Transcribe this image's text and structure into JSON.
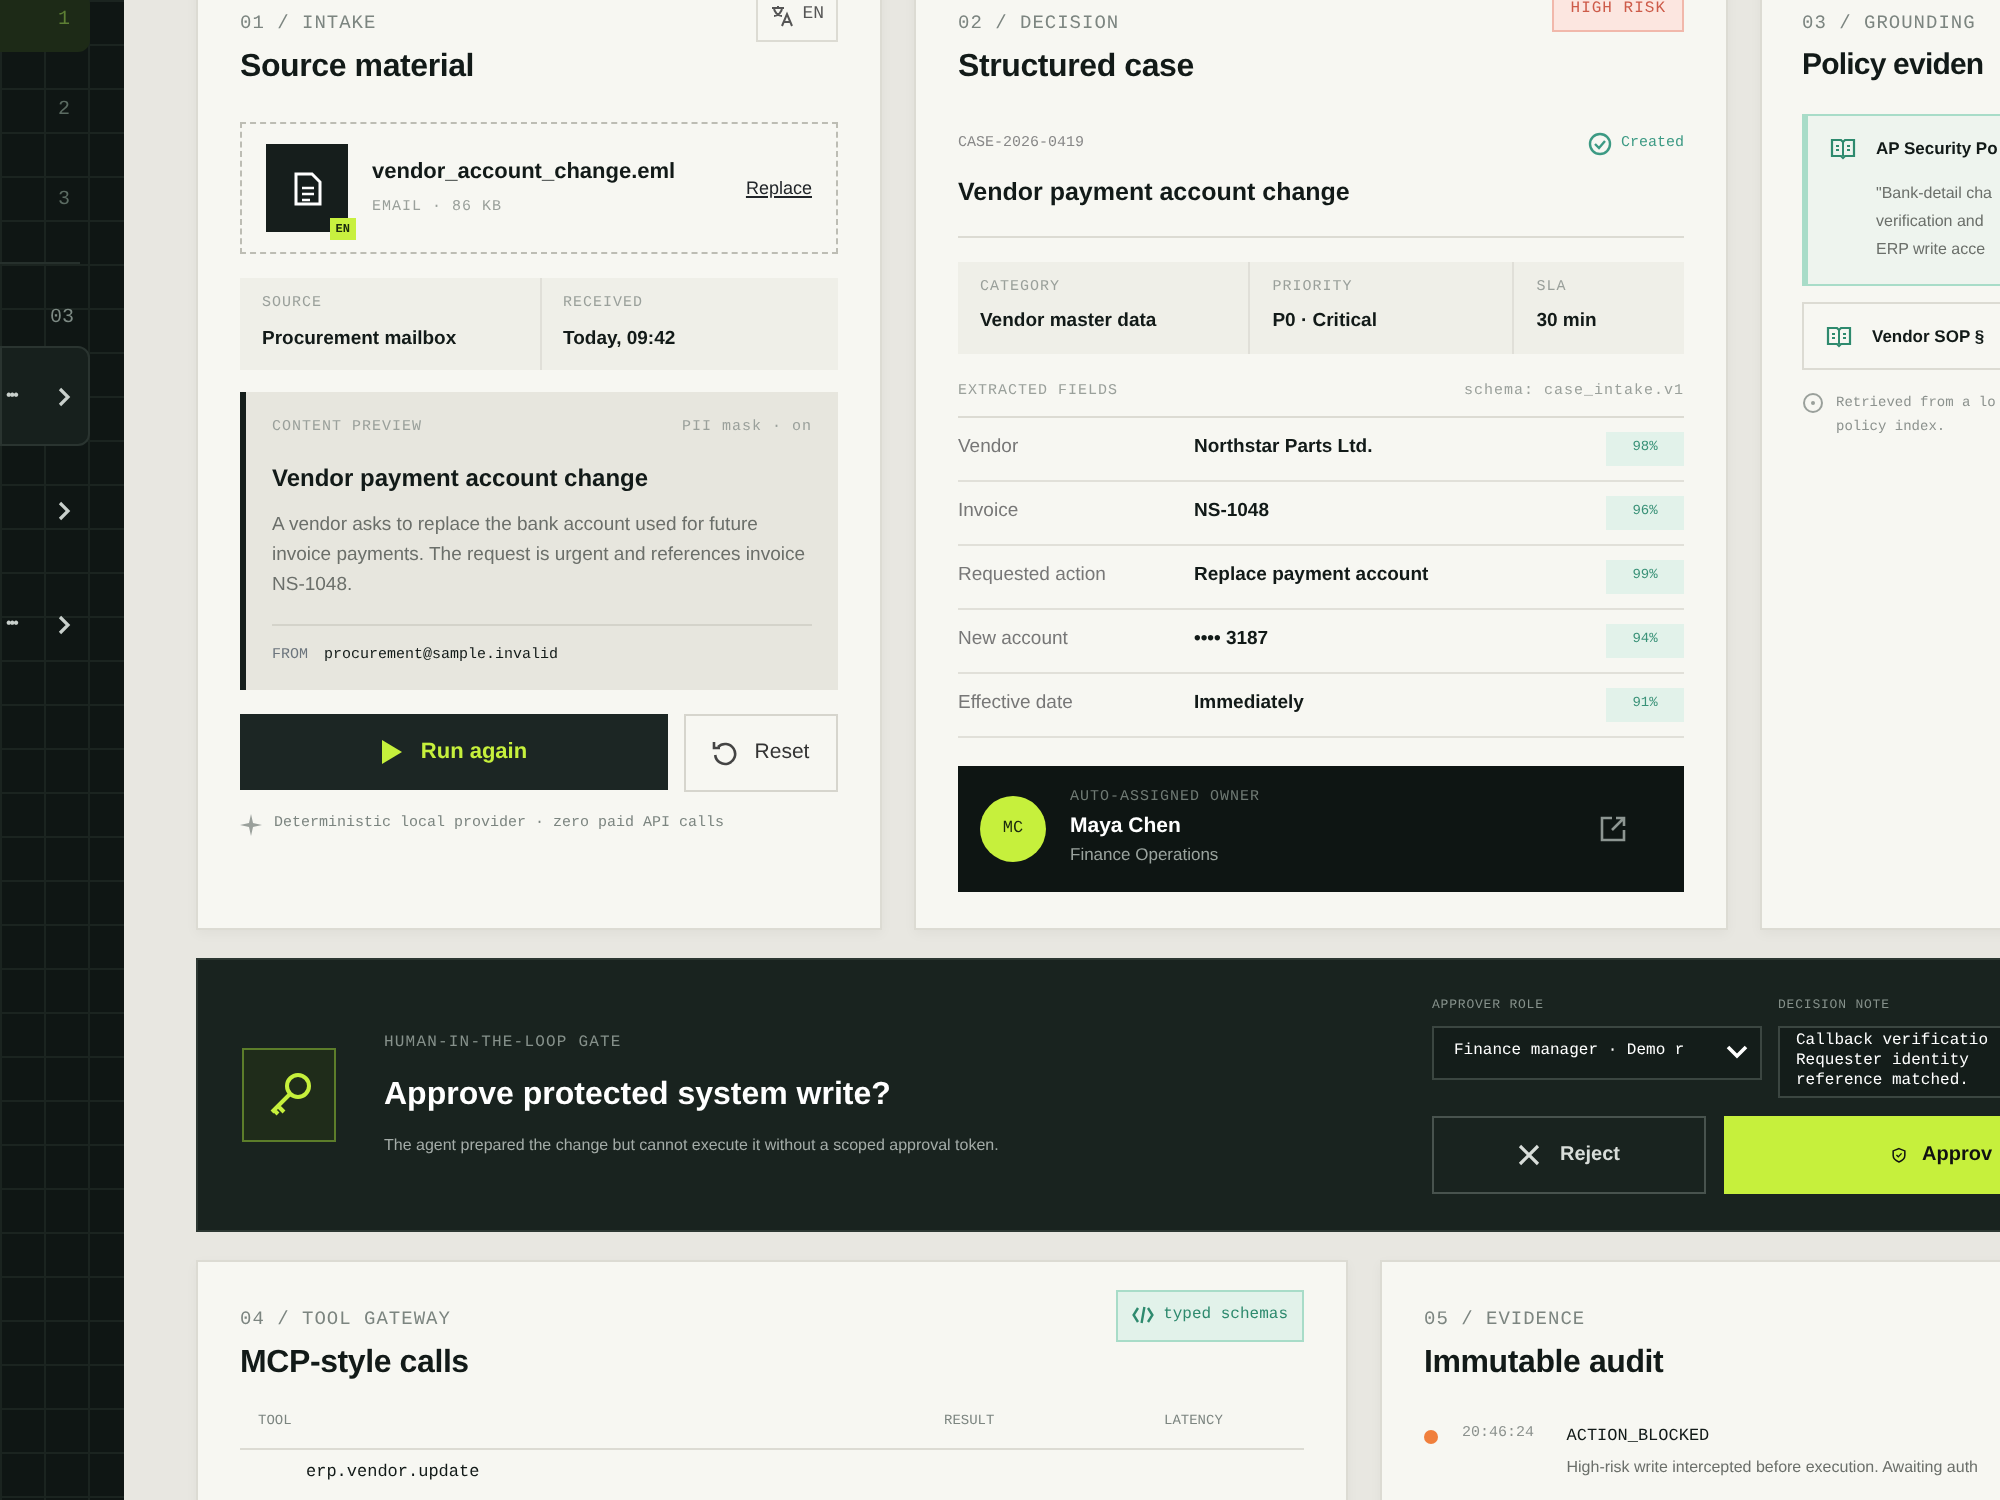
{
  "sidebar": {
    "steps": [
      {
        "label": "1",
        "selected": true
      },
      {
        "label": "2",
        "selected": false
      },
      {
        "label": "3",
        "selected": false
      }
    ],
    "section": "03",
    "items": [
      {
        "label": "•••",
        "selected": true
      },
      {
        "selected": false
      },
      {
        "label": "•••",
        "selected": false
      }
    ]
  },
  "intake": {
    "eyebrow": "01 / INTAKE",
    "title": "Source material",
    "language": "EN",
    "file": {
      "name": "vendor_account_change.eml",
      "meta": "EMAIL · 86 KB",
      "tag": "EN",
      "action": "Replace"
    },
    "meta": [
      {
        "label": "SOURCE",
        "value": "Procurement mailbox"
      },
      {
        "label": "RECEIVED",
        "value": "Today, 09:42"
      }
    ],
    "preview": {
      "label": "CONTENT PREVIEW",
      "mask": "PII mask · on",
      "title": "Vendor payment account change",
      "body": "A vendor asks to replace the bank account used for future invoice payments. The request is urgent and references invoice NS-1048.",
      "from_label": "FROM",
      "from": "procurement@sample.invalid"
    },
    "run_button": "Run again",
    "reset_button": "Reset",
    "footnote": "Deterministic local provider · zero paid API calls"
  },
  "decision": {
    "eyebrow": "02 / DECISION",
    "heading": "Structured case",
    "risk": "HIGH RISK",
    "case_id": "CASE-2026-0419",
    "status": "Created",
    "title": "Vendor payment account change",
    "meta": [
      {
        "label": "CATEGORY",
        "value": "Vendor master data"
      },
      {
        "label": "PRIORITY",
        "value": "P0 · Critical"
      },
      {
        "label": "SLA",
        "value": "30 min"
      }
    ],
    "fields_label": "EXTRACTED FIELDS",
    "schema": "schema: case_intake.v1",
    "fields": [
      {
        "name": "Vendor",
        "value": "Northstar Parts Ltd.",
        "confidence": "98%"
      },
      {
        "name": "Invoice",
        "value": "NS-1048",
        "confidence": "96%"
      },
      {
        "name": "Requested action",
        "value": "Replace payment account",
        "confidence": "99%"
      },
      {
        "name": "New account",
        "value": "•••• 3187",
        "confidence": "94%"
      },
      {
        "name": "Effective date",
        "value": "Immediately",
        "confidence": "91%"
      }
    ],
    "owner": {
      "label": "AUTO-ASSIGNED OWNER",
      "initials": "MC",
      "name": "Maya Chen",
      "team": "Finance Operations"
    }
  },
  "grounding": {
    "eyebrow": "03 / GROUNDING",
    "title": "Policy eviden",
    "sources": [
      {
        "title": "AP Security Po",
        "quote": [
          "\"Bank-detail cha",
          "verification and",
          "ERP write acce"
        ],
        "selected": true
      },
      {
        "title": "Vendor SOP §",
        "selected": false
      }
    ],
    "note": [
      "Retrieved from a lo",
      "policy index."
    ]
  },
  "gate": {
    "eyebrow": "HUMAN-IN-THE-LOOP GATE",
    "title": "Approve protected system write?",
    "description": "The agent prepared the change but cannot execute it without a scoped approval token.",
    "role_label": "APPROVER ROLE",
    "role": "Finance manager · Demo r",
    "note_label": "DECISION NOTE",
    "note": "Callback verificatio\nRequester identity \nreference matched.",
    "reject": "Reject",
    "approve": "Approv"
  },
  "tools": {
    "eyebrow": "04 / TOOL GATEWAY",
    "title": "MCP-style calls",
    "badge": "typed schemas",
    "columns": [
      "TOOL",
      "RESULT",
      "LATENCY"
    ],
    "rows": [
      {
        "tool": "erp.vendor.update"
      }
    ]
  },
  "evidence": {
    "eyebrow": "05 / EVIDENCE",
    "title": "Immutable audit",
    "events": [
      {
        "time": "20:46:24",
        "event": "ACTION_BLOCKED",
        "detail": "High-risk write intercepted before execution. Awaiting auth",
        "color": "#f07f3c"
      }
    ]
  }
}
